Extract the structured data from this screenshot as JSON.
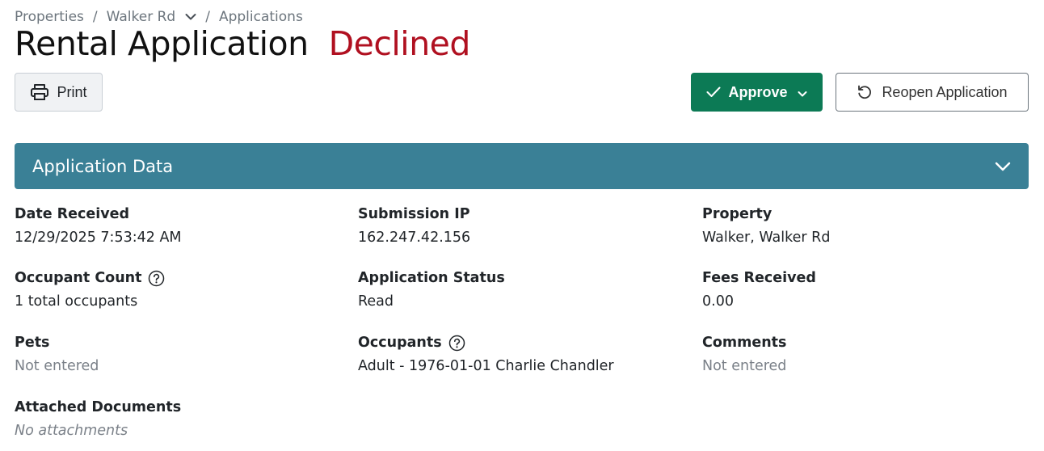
{
  "breadcrumb": {
    "items": [
      "Properties",
      "Walker Rd",
      "Applications"
    ],
    "separator": "/"
  },
  "header": {
    "title": "Rental Application",
    "status": "Declined",
    "status_color": "#b01020"
  },
  "toolbar": {
    "print_label": "Print",
    "approve_label": "Approve",
    "reopen_label": "Reopen Application",
    "approve_color": "#0c7a55"
  },
  "panel": {
    "title": "Application Data",
    "color": "#3a8096"
  },
  "fields": {
    "date_received": {
      "label": "Date Received",
      "value": "12/29/2025 7:53:42 AM"
    },
    "submission_ip": {
      "label": "Submission IP",
      "value": "162.247.42.156"
    },
    "property": {
      "label": "Property",
      "value": "Walker, Walker Rd"
    },
    "occupant_count": {
      "label": "Occupant Count",
      "value": "1 total occupants"
    },
    "application_status": {
      "label": "Application Status",
      "value": "Read"
    },
    "fees_received": {
      "label": "Fees Received",
      "value": "0.00"
    },
    "pets": {
      "label": "Pets",
      "value": "Not entered"
    },
    "occupants": {
      "label": "Occupants",
      "value": "Adult - 1976-01-01 Charlie Chandler"
    },
    "comments": {
      "label": "Comments",
      "value": "Not entered"
    },
    "attached_documents": {
      "label": "Attached Documents",
      "value": "No attachments"
    }
  },
  "icons": {
    "print": "printer-icon",
    "approve": "check-icon",
    "approve_menu": "chevron-down-icon",
    "reopen": "undo-icon",
    "panel_toggle": "chevron-down-icon",
    "help": "question-circle-icon"
  }
}
